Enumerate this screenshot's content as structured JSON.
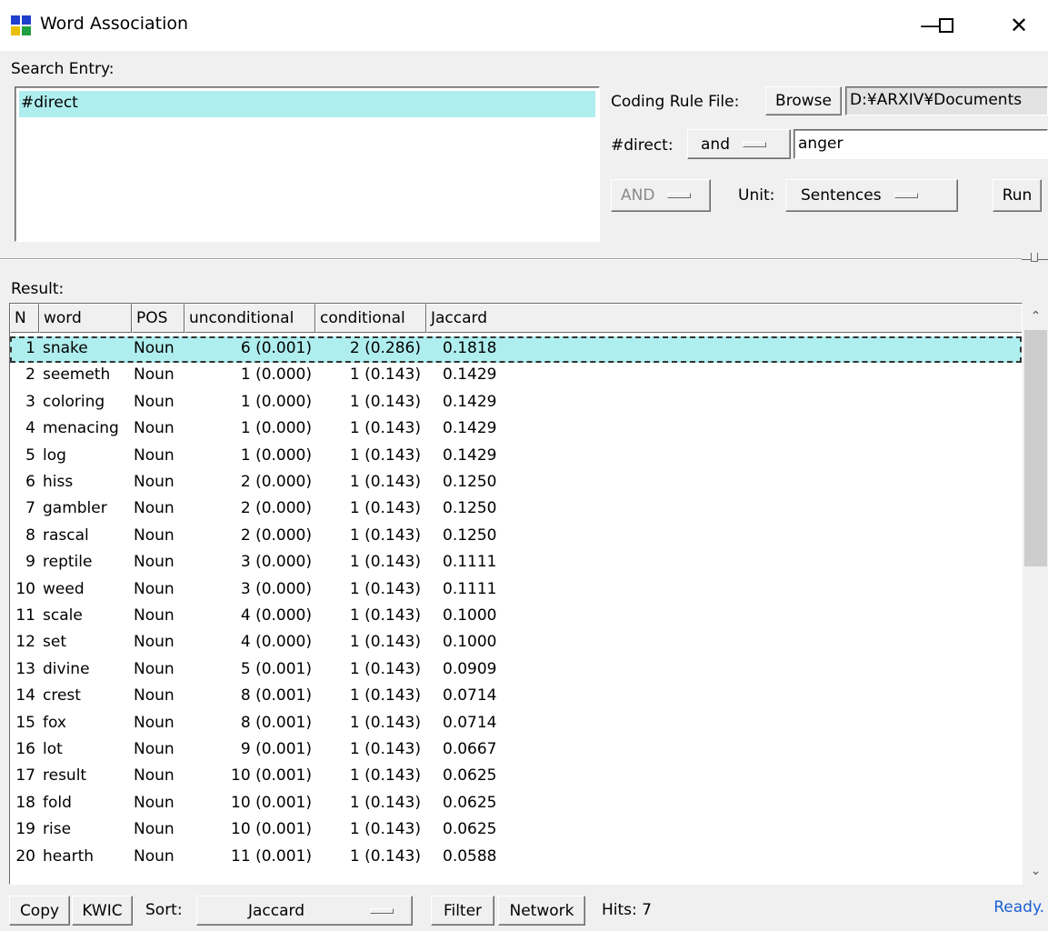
{
  "window": {
    "title": "Word Association",
    "min_glyph": "—",
    "max_glyph": "☐",
    "close_glyph": "✕"
  },
  "search": {
    "label": "Search Entry:",
    "items": [
      "#direct"
    ]
  },
  "coding": {
    "label": "Coding Rule File:",
    "browse": "Browse",
    "path": "D:¥ARXIV¥Documents"
  },
  "condition": {
    "label": "#direct:",
    "op": "and",
    "value": "anger"
  },
  "controls": {
    "logic": "AND",
    "unit_label": "Unit:",
    "unit": "Sentences",
    "run": "Run"
  },
  "result": {
    "label": "Result:",
    "columns": [
      "N",
      "word",
      "POS",
      "unconditional",
      "conditional",
      "Jaccard"
    ],
    "rows": [
      [
        "1",
        "snake",
        "Noun",
        "6 (0.001)",
        "2 (0.286)",
        "0.1818"
      ],
      [
        "2",
        "seemeth",
        "Noun",
        "1 (0.000)",
        "1 (0.143)",
        "0.1429"
      ],
      [
        "3",
        "coloring",
        "Noun",
        "1 (0.000)",
        "1 (0.143)",
        "0.1429"
      ],
      [
        "4",
        "menacing",
        "Noun",
        "1 (0.000)",
        "1 (0.143)",
        "0.1429"
      ],
      [
        "5",
        "log",
        "Noun",
        "1 (0.000)",
        "1 (0.143)",
        "0.1429"
      ],
      [
        "6",
        "hiss",
        "Noun",
        "2 (0.000)",
        "1 (0.143)",
        "0.1250"
      ],
      [
        "7",
        "gambler",
        "Noun",
        "2 (0.000)",
        "1 (0.143)",
        "0.1250"
      ],
      [
        "8",
        "rascal",
        "Noun",
        "2 (0.000)",
        "1 (0.143)",
        "0.1250"
      ],
      [
        "9",
        "reptile",
        "Noun",
        "3 (0.000)",
        "1 (0.143)",
        "0.1111"
      ],
      [
        "10",
        "weed",
        "Noun",
        "3 (0.000)",
        "1 (0.143)",
        "0.1111"
      ],
      [
        "11",
        "scale",
        "Noun",
        "4 (0.000)",
        "1 (0.143)",
        "0.1000"
      ],
      [
        "12",
        "set",
        "Noun",
        "4 (0.000)",
        "1 (0.143)",
        "0.1000"
      ],
      [
        "13",
        "divine",
        "Noun",
        "5 (0.001)",
        "1 (0.143)",
        "0.0909"
      ],
      [
        "14",
        "crest",
        "Noun",
        "8 (0.001)",
        "1 (0.143)",
        "0.0714"
      ],
      [
        "15",
        "fox",
        "Noun",
        "8 (0.001)",
        "1 (0.143)",
        "0.0714"
      ],
      [
        "16",
        "lot",
        "Noun",
        "9 (0.001)",
        "1 (0.143)",
        "0.0667"
      ],
      [
        "17",
        "result",
        "Noun",
        "10 (0.001)",
        "1 (0.143)",
        "0.0625"
      ],
      [
        "18",
        "fold",
        "Noun",
        "10 (0.001)",
        "1 (0.143)",
        "0.0625"
      ],
      [
        "19",
        "rise",
        "Noun",
        "10 (0.001)",
        "1 (0.143)",
        "0.0625"
      ],
      [
        "20",
        "hearth",
        "Noun",
        "11 (0.001)",
        "1 (0.143)",
        "0.0588"
      ]
    ]
  },
  "bottom": {
    "copy": "Copy",
    "kwic": "KWIC",
    "sort_label": "Sort:",
    "sort": "Jaccard",
    "filter": "Filter",
    "network": "Network",
    "hits": "Hits: 7",
    "status": "Ready."
  },
  "colors": {
    "selection": "#afeeee",
    "status": "#1a5fd4"
  }
}
